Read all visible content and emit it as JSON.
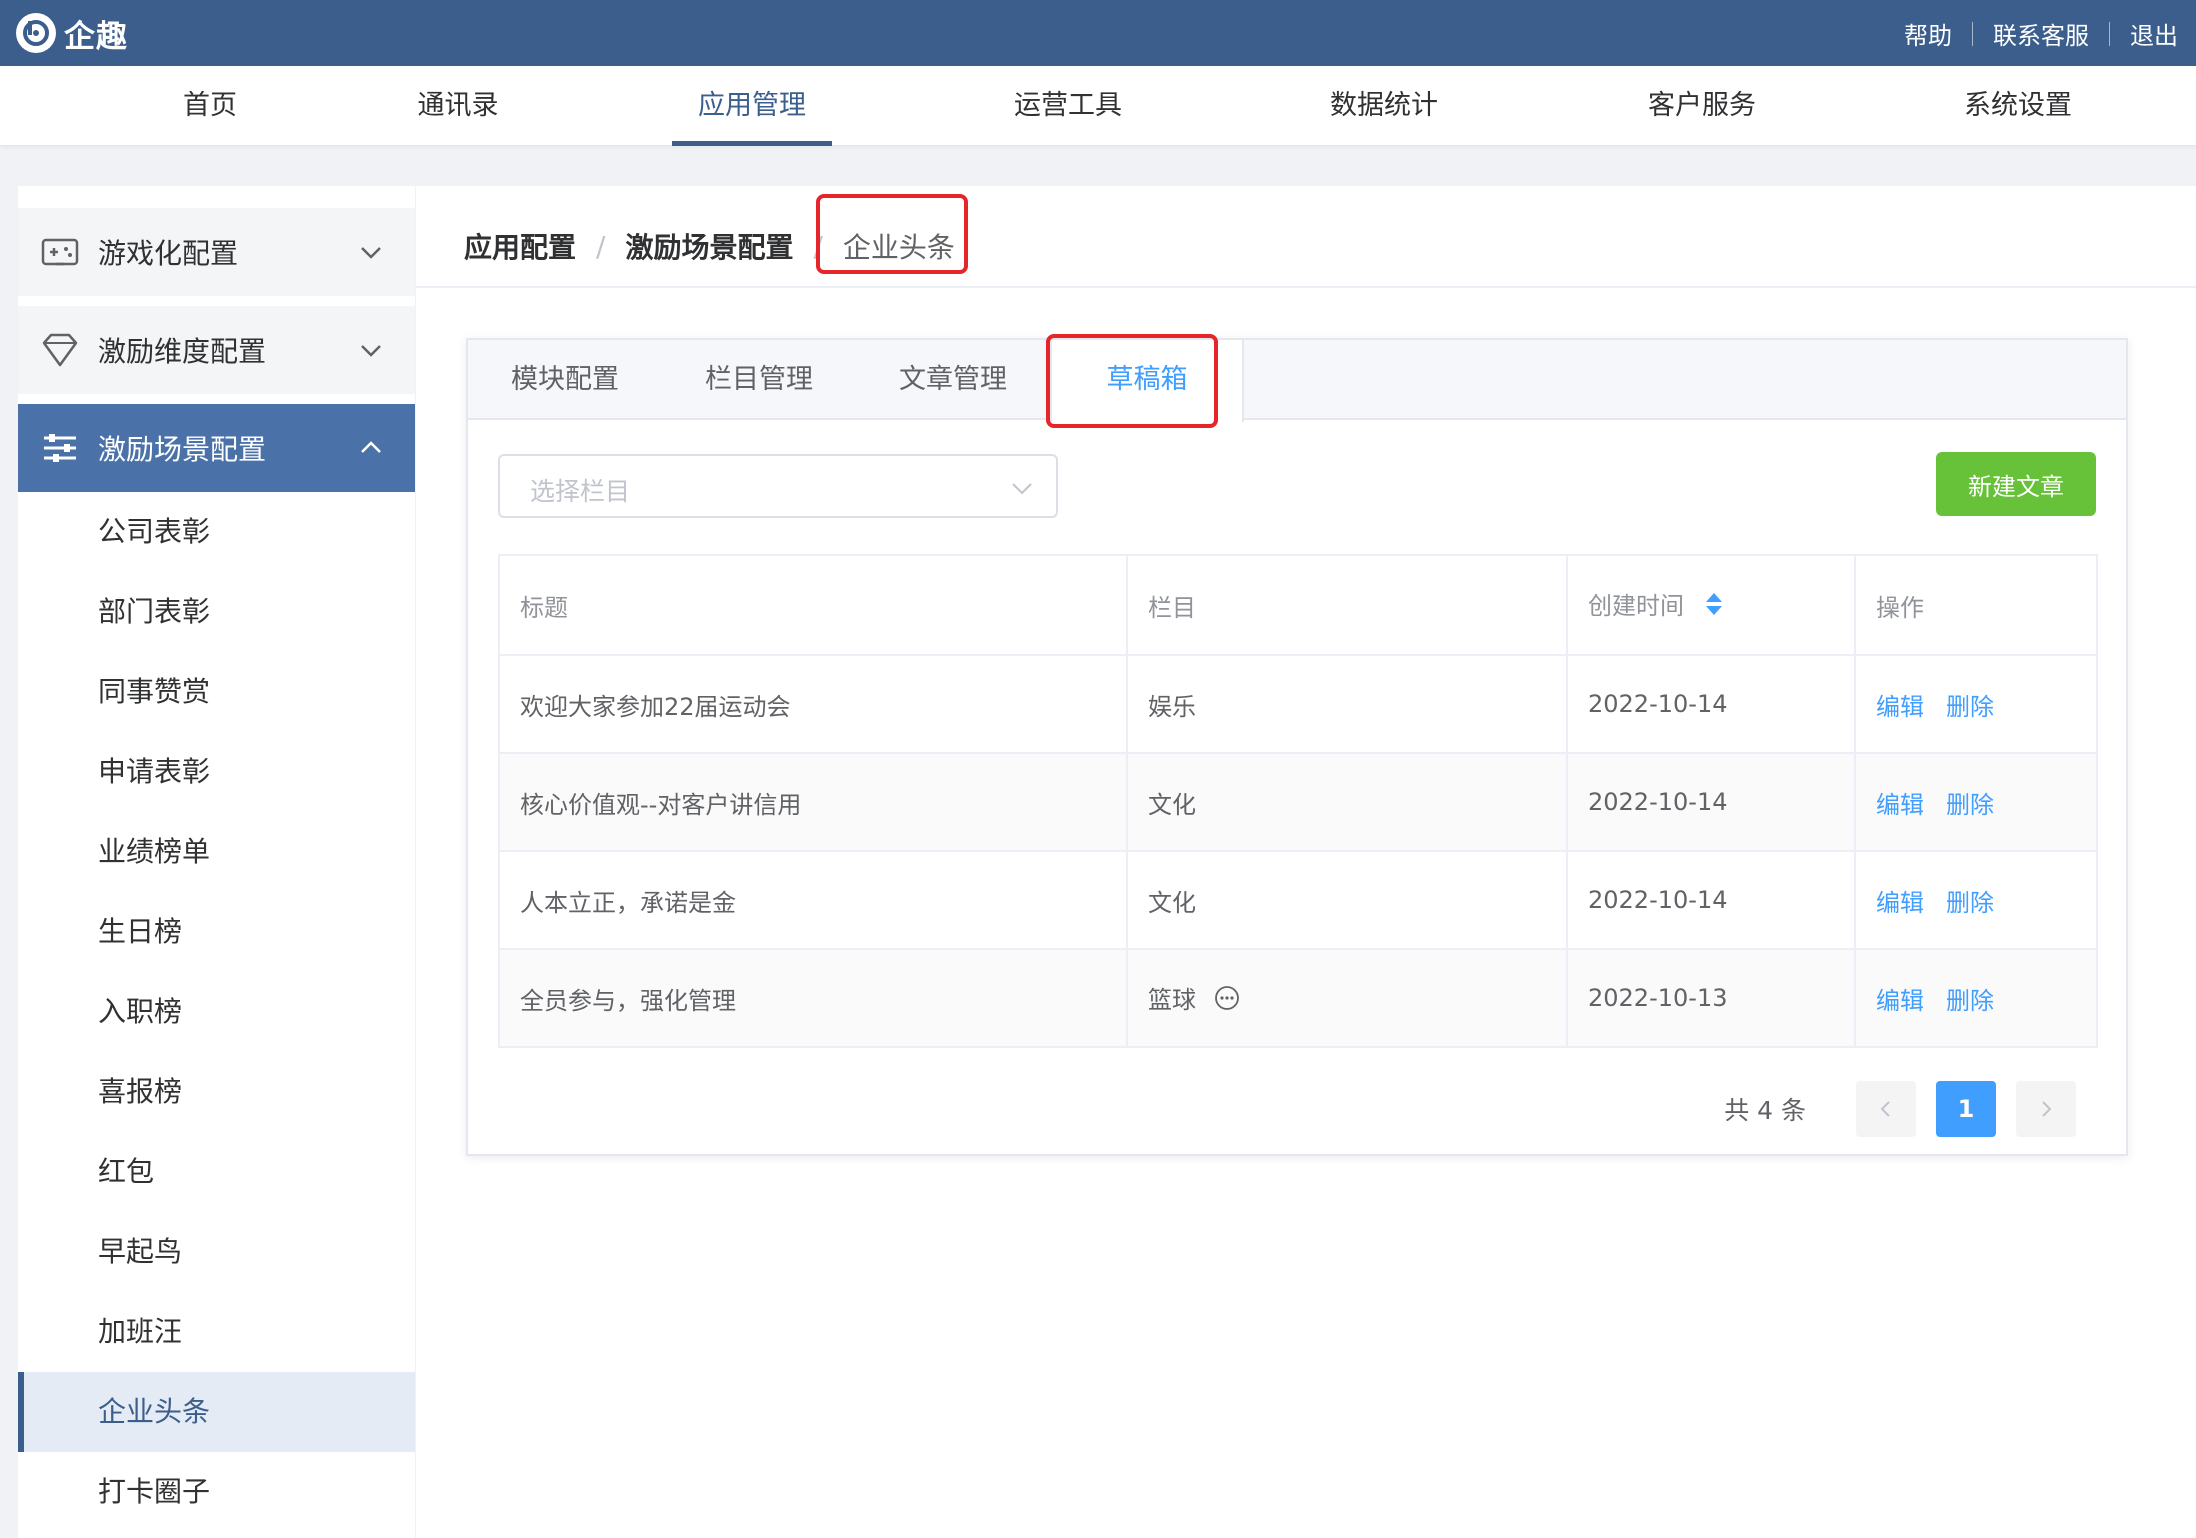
{
  "header": {
    "brand": "企趣",
    "links": [
      "帮助",
      "联系客服",
      "退出"
    ]
  },
  "nav": {
    "items": [
      "首页",
      "通讯录",
      "应用管理",
      "运营工具",
      "数据统计",
      "客户服务",
      "系统设置"
    ],
    "active": "应用管理"
  },
  "sidebar": {
    "groups": [
      {
        "label": "游戏化配置",
        "icon": "gamepad-icon",
        "expanded": false
      },
      {
        "label": "激励维度配置",
        "icon": "diamond-icon",
        "expanded": false
      },
      {
        "label": "激励场景配置",
        "icon": "sliders-icon",
        "expanded": true
      }
    ],
    "sub_items": [
      "公司表彰",
      "部门表彰",
      "同事赞赏",
      "申请表彰",
      "业绩榜单",
      "生日榜",
      "入职榜",
      "喜报榜",
      "红包",
      "早起鸟",
      "加班汪",
      "企业头条",
      "打卡圈子"
    ],
    "active_sub": "企业头条"
  },
  "breadcrumb": {
    "items": [
      "应用配置",
      "激励场景配置"
    ],
    "current": "企业头条",
    "separator": "/"
  },
  "tabs": {
    "items": [
      "模块配置",
      "栏目管理",
      "文章管理",
      "草稿箱"
    ],
    "active": "草稿箱"
  },
  "filter": {
    "placeholder": "选择栏目"
  },
  "actions": {
    "new_article": "新建文章"
  },
  "table": {
    "columns": [
      "标题",
      "栏目",
      "创建时间",
      "操作"
    ],
    "rows": [
      {
        "title": "欢迎大家参加22届运动会",
        "column": "娱乐",
        "created": "2022-10-14",
        "ops": [
          "编辑",
          "删除"
        ]
      },
      {
        "title": "核心价值观--对客户讲信用",
        "column": "文化",
        "created": "2022-10-14",
        "ops": [
          "编辑",
          "删除"
        ]
      },
      {
        "title": "人本立正，承诺是金",
        "column": "文化",
        "created": "2022-10-14",
        "ops": [
          "编辑",
          "删除"
        ]
      },
      {
        "title": "全员参与，强化管理",
        "column": "篮球",
        "created": "2022-10-13",
        "ops": [
          "编辑",
          "删除"
        ]
      }
    ]
  },
  "pagination": {
    "total_text": "共 4 条",
    "current_page": "1"
  },
  "colors": {
    "header_bg": "#3b5e8c",
    "accent_blue": "#409eff",
    "success_green": "#67c23a",
    "highlight_red": "#e5252a"
  }
}
